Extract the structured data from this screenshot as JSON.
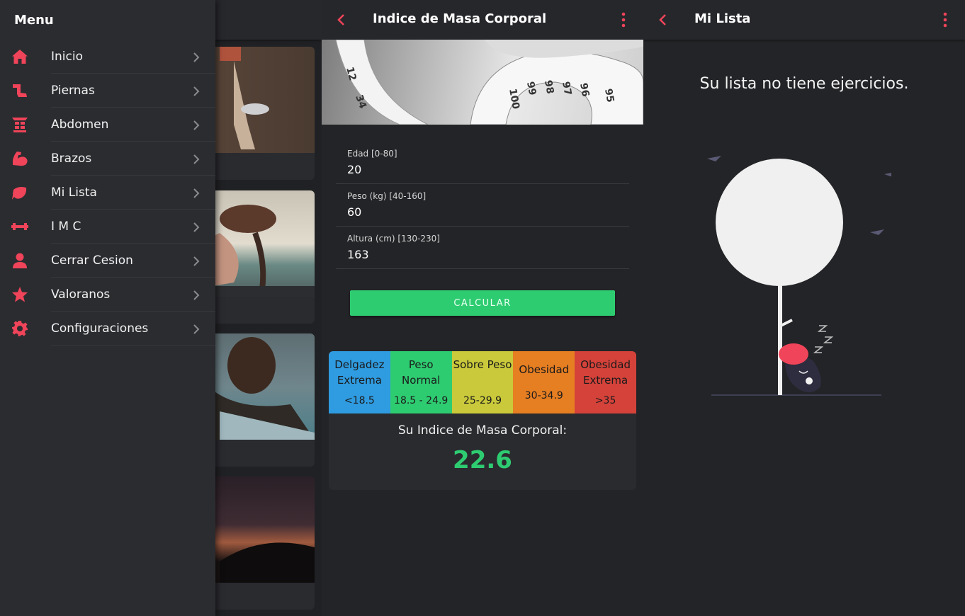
{
  "colors": {
    "accent": "#ef4459",
    "green": "#2ecc71",
    "scale_blue": "#2f9be0",
    "scale_green": "#2ecc71",
    "scale_yellow": "#c9c93b",
    "scale_orange": "#e67e22",
    "scale_red": "#d4423a"
  },
  "drawer": {
    "title": "Menu",
    "items": [
      {
        "label": "Inicio",
        "icon": "home-icon"
      },
      {
        "label": "Piernas",
        "icon": "leg-icon"
      },
      {
        "label": "Abdomen",
        "icon": "abs-icon"
      },
      {
        "label": "Brazos",
        "icon": "arm-icon"
      },
      {
        "label": "Mi Lista",
        "icon": "leaf-icon"
      },
      {
        "label": "I M C",
        "icon": "dumbbell-icon"
      },
      {
        "label": "Cerrar Cesion",
        "icon": "user-icon"
      },
      {
        "label": "Valoranos",
        "icon": "star-icon"
      },
      {
        "label": "Configuraciones",
        "icon": "gear-icon"
      }
    ]
  },
  "imc": {
    "title": "Indice de Masa Corporal",
    "fields": [
      {
        "label": "Edad [0-80]",
        "value": "20"
      },
      {
        "label": "Peso (kg) [40-160]",
        "value": "60"
      },
      {
        "label": "Altura (cm) [130-230]",
        "value": "163"
      }
    ],
    "button_label": "CALCULAR",
    "scale": [
      {
        "name": "Delgadez Extrema",
        "range": "<18.5"
      },
      {
        "name": "Peso Normal",
        "range": "18.5 - 24.9"
      },
      {
        "name": "Sobre Peso",
        "range": "25-29.9"
      },
      {
        "name": "Obesidad",
        "range": "30-34.9"
      },
      {
        "name": "Obesidad Extrema",
        "range": ">35"
      }
    ],
    "result_label": "Su Indice de Masa Corporal:",
    "result_value": "22.6"
  },
  "list": {
    "title": "Mi Lista",
    "empty_message": "Su lista no tiene ejercicios."
  }
}
